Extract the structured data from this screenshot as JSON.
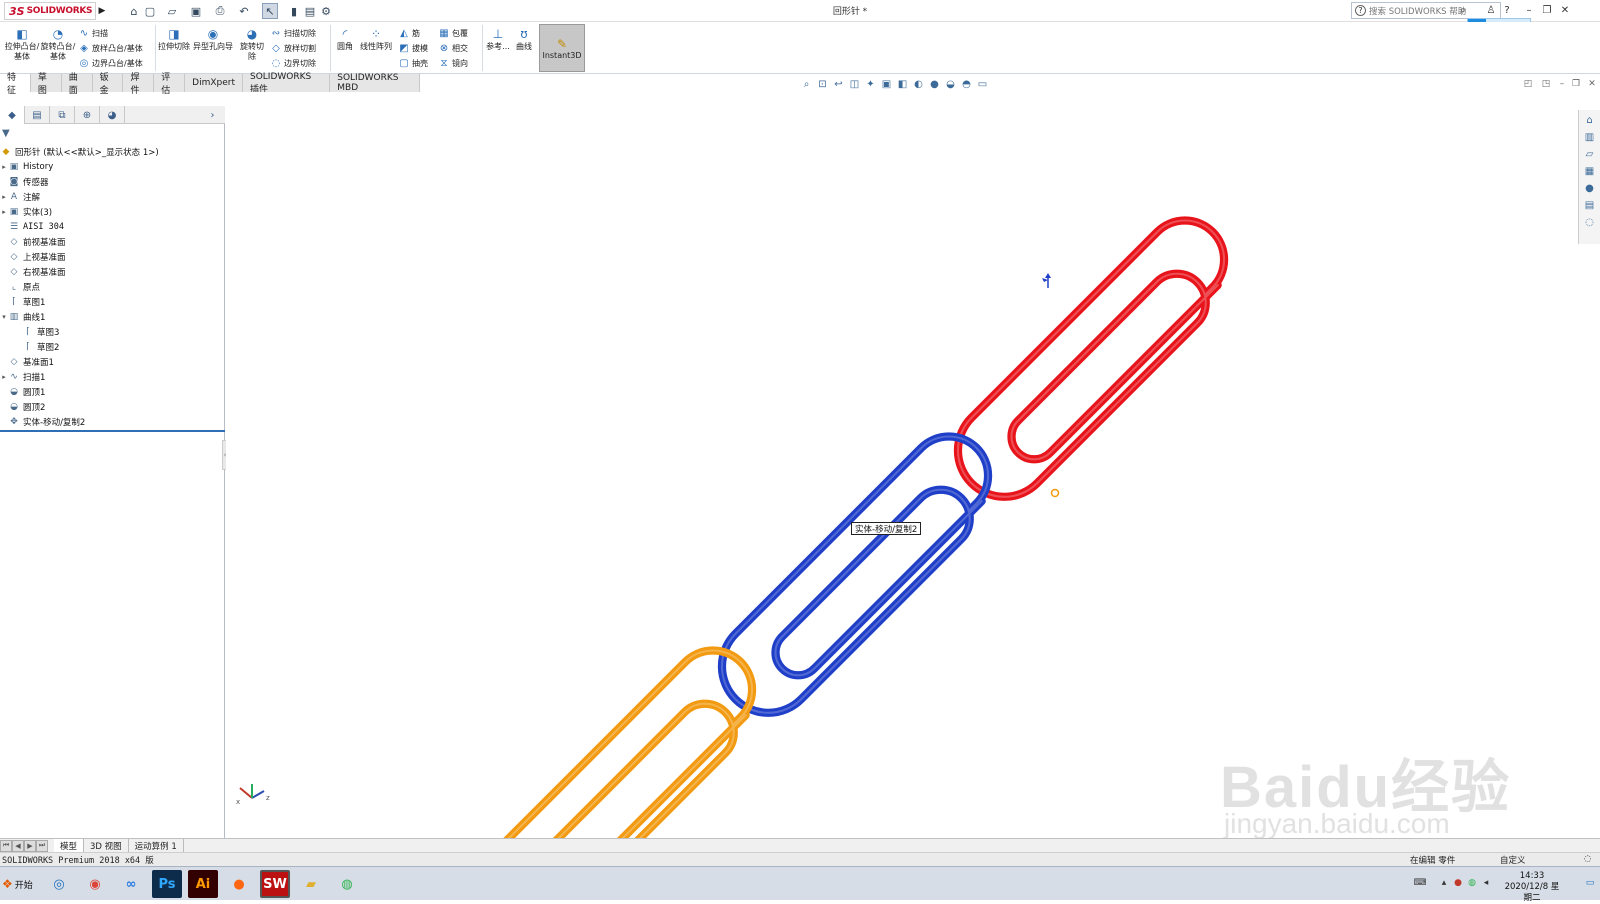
{
  "app": {
    "brand_ds": "3S",
    "brand_name": "SOLIDWORKS",
    "document_title": "回形针 *",
    "help_search_placeholder": "搜索 SOLIDWORKS 帮助"
  },
  "ribbon": {
    "extrude_boss": "拉伸凸台/基体",
    "revolve_boss": "旋转凸台/基体",
    "sweep": "扫描",
    "loft_boss": "放样凸台/基体",
    "boundary_boss": "边界凸台/基体",
    "extrude_cut": "拉伸切除",
    "hole_wizard": "异型孔向导",
    "revolve_cut": "旋转切除",
    "sweep_cut": "扫描切除",
    "loft_cut": "放样切割",
    "boundary_cut": "边界切除",
    "fillet": "圆角",
    "linear_pattern": "线性阵列",
    "rib": "筋",
    "draft": "拔模",
    "shell": "抽壳",
    "wrap": "包覆",
    "intersect": "相交",
    "mirror": "镜向",
    "reference": "参考...",
    "curves": "曲线",
    "instant3d": "Instant3D"
  },
  "command_tabs": [
    "特征",
    "草图",
    "曲面",
    "钣金",
    "焊件",
    "评估",
    "DimXpert",
    "SOLIDWORKS 插件",
    "SOLIDWORKS MBD"
  ],
  "tree": {
    "root": "回形针  (默认<<默认>_显示状态 1>)",
    "items": [
      {
        "label": "History",
        "toggle": "▸",
        "icon": "history-icon"
      },
      {
        "label": "传感器",
        "toggle": "",
        "icon": "sensor-icon"
      },
      {
        "label": "注解",
        "toggle": "▸",
        "icon": "annotation-icon"
      },
      {
        "label": "实体(3)",
        "toggle": "▸",
        "icon": "solid-bodies-icon"
      },
      {
        "label": "AISI 304",
        "toggle": "",
        "icon": "material-icon"
      },
      {
        "label": "前视基准面",
        "toggle": "",
        "icon": "plane-icon"
      },
      {
        "label": "上视基准面",
        "toggle": "",
        "icon": "plane-icon"
      },
      {
        "label": "右视基准面",
        "toggle": "",
        "icon": "plane-icon"
      },
      {
        "label": "原点",
        "toggle": "",
        "icon": "origin-icon"
      },
      {
        "label": "草图1",
        "toggle": "",
        "icon": "sketch-icon"
      },
      {
        "label": "曲线1",
        "toggle": "▾",
        "icon": "curve-icon"
      },
      {
        "label": "草图3",
        "toggle": "",
        "icon": "sketch-icon",
        "indent": true
      },
      {
        "label": "草图2",
        "toggle": "",
        "icon": "sketch-icon",
        "indent": true
      },
      {
        "label": "基准面1",
        "toggle": "",
        "icon": "plane-icon"
      },
      {
        "label": "扫描1",
        "toggle": "▸",
        "icon": "sweep-icon"
      },
      {
        "label": "圆顶1",
        "toggle": "",
        "icon": "dome-icon"
      },
      {
        "label": "圆顶2",
        "toggle": "",
        "icon": "dome-icon"
      },
      {
        "label": "实体-移动/复制2",
        "toggle": "",
        "icon": "move-copy-icon"
      }
    ]
  },
  "viewport": {
    "tooltip": "实体-移动/复制2",
    "clip_colors": {
      "red": "#e8141b",
      "blue": "#1f3fc8",
      "orange": "#f29a11"
    }
  },
  "bottom_tabs": [
    "模型",
    "3D 视图",
    "运动算例 1"
  ],
  "status": {
    "left": "SOLIDWORKS Premium 2018 x64 版",
    "editing": "在编辑  零件",
    "custom": "自定义"
  },
  "taskbar": {
    "start": "开始",
    "time": "14:33",
    "date": "2020/12/8 星期二"
  },
  "watermark": {
    "main": "Baidu经验",
    "url": "jingyan.baidu.com"
  }
}
